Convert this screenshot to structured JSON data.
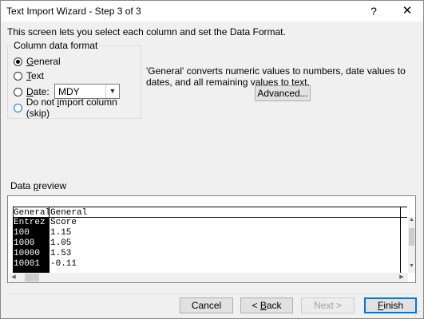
{
  "window": {
    "title": "Text Import Wizard - Step 3 of 3",
    "help_label": "?",
    "close_label": "✕"
  },
  "intro_text": "This screen lets you select each column and set the Data Format.",
  "format_group": {
    "title": "Column data format",
    "options": [
      {
        "label": "General",
        "underline": "G",
        "rest": "eneral",
        "checked": true
      },
      {
        "label": "Text",
        "underline": "T",
        "rest": "ext",
        "checked": false
      },
      {
        "label_before": "",
        "underline": "D",
        "rest": "ate:",
        "checked": false
      },
      {
        "label_before": "Do not ",
        "underline": "i",
        "rest": "mport column (skip)",
        "checked": false
      }
    ],
    "date_format": "MDY"
  },
  "description": "'General' converts numeric values to numbers, date values to dates, and all remaining values to text.",
  "advanced_label": "Advanced...",
  "preview": {
    "title": "Data preview",
    "title_underline": "p",
    "headers": [
      "General",
      "General"
    ],
    "rows": [
      [
        "Entrez",
        "Score"
      ],
      [
        "100",
        "1.15"
      ],
      [
        "1000",
        "1.05"
      ],
      [
        "10000",
        "1.53"
      ],
      [
        "10001",
        "-0.11"
      ]
    ],
    "selected_column": 0
  },
  "buttons": {
    "cancel": "Cancel",
    "back_before": "< ",
    "back_underline": "B",
    "back_rest": "ack",
    "next_label": "Next >",
    "finish_underline": "F",
    "finish_rest": "inish"
  },
  "colors": {
    "accent": "#0078d7",
    "focus_ring": "#1e73d8"
  },
  "icons": {
    "dropdown": "chevron-down-icon",
    "scroll_up": "arrow-up-icon",
    "scroll_down": "arrow-down-icon",
    "scroll_left": "arrow-left-icon",
    "scroll_right": "arrow-right-icon"
  }
}
